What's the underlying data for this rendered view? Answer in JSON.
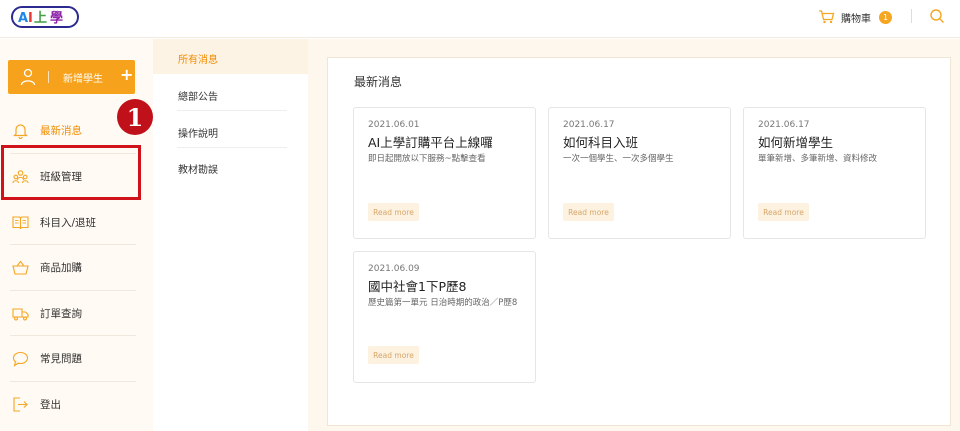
{
  "header": {
    "logo_text": "AI上學",
    "cart_label": "購物車",
    "cart_count": "1"
  },
  "sidebar": {
    "add_student_label": "新增學生",
    "items": [
      {
        "label": "最新消息",
        "icon": "bell-icon"
      },
      {
        "label": "班級管理",
        "icon": "people-icon"
      },
      {
        "label": "科目入/退班",
        "icon": "book-icon"
      },
      {
        "label": "商品加購",
        "icon": "basket-icon"
      },
      {
        "label": "訂單查詢",
        "icon": "truck-icon"
      },
      {
        "label": "常見問題",
        "icon": "chat-bubble-icon"
      },
      {
        "label": "登出",
        "icon": "logout-icon"
      }
    ],
    "annotation_number": "1"
  },
  "submenu": {
    "items": [
      {
        "label": "所有消息"
      },
      {
        "label": "總部公告"
      },
      {
        "label": "操作說明"
      },
      {
        "label": "教材勘誤"
      }
    ]
  },
  "main": {
    "title": "最新消息",
    "cards": [
      {
        "date": "2021.06.01",
        "title": "AI上學訂購平台上線囉",
        "desc": "即日起開放以下服務~點擊查看",
        "more": "Read more"
      },
      {
        "date": "2021.06.17",
        "title": "如何科目入班",
        "desc": "一次一個學生、一次多個學生",
        "more": "Read more"
      },
      {
        "date": "2021.06.17",
        "title": "如何新增學生",
        "desc": "單筆新增、多筆新增、資料修改",
        "more": "Read more"
      },
      {
        "date": "2021.06.09",
        "title": "國中社會1下P歷8",
        "desc": "歷史篇第一單元 日治時期的政治／P歷8",
        "more": "Read more"
      }
    ]
  },
  "colors": {
    "accent": "#f6a21c",
    "highlight": "#d0121b"
  }
}
